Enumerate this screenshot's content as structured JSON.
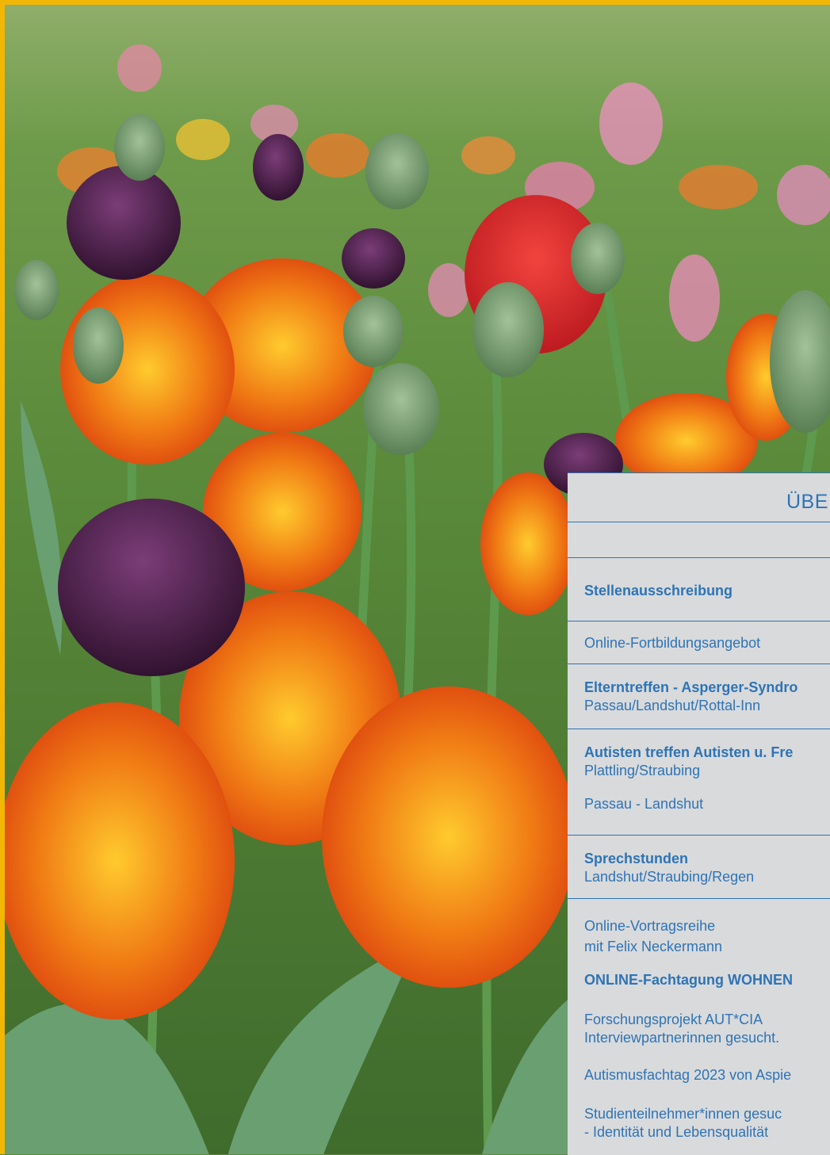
{
  "panel": {
    "title": "ÜBE",
    "entries": [
      {
        "lines": [
          "Stellenausschreibung"
        ],
        "bold": [
          true
        ]
      },
      {
        "lines": [
          "Online-Fortbildungsangebot"
        ],
        "bold": [
          false
        ]
      },
      {
        "lines": [
          "Elterntreffen - Asperger-Syndro",
          "Passau/Landshut/Rottal-Inn"
        ],
        "bold": [
          true,
          false
        ]
      },
      {
        "lines": [
          "Autisten treffen Autisten u. Fre",
          "Plattling/Straubing",
          "Passau - Landshut"
        ],
        "bold": [
          true,
          false,
          false
        ]
      },
      {
        "lines": [
          "Sprechstunden",
          "Landshut/Straubing/Regen"
        ],
        "bold": [
          true,
          false
        ]
      },
      {
        "lines": [
          "Online-Vortragsreihe",
          "mit Felix Neckermann",
          "ONLINE-Fachtagung WOHNEN",
          "Forschungsprojekt AUT*CIA",
          "Interviewpartnerinnen gesucht.",
          "Autismusfachtag 2023 von Aspie",
          "Studienteilnehmer*innen gesuc",
          "- Identität und Lebensqualität"
        ],
        "bold": [
          false,
          false,
          true,
          false,
          false,
          false,
          false,
          false
        ]
      }
    ]
  },
  "colors": {
    "accent": "#2e74b5",
    "frame": "#f2b705",
    "panel_bg": "#d9dadc"
  }
}
